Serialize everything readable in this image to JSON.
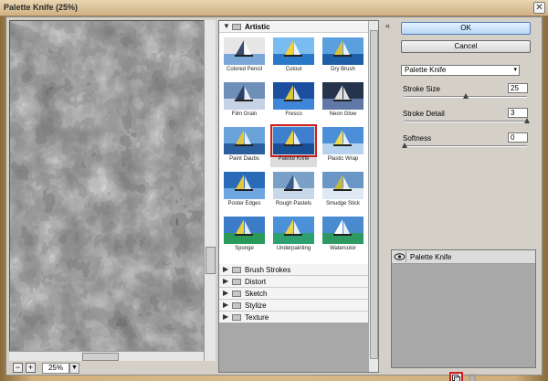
{
  "window": {
    "title": "Palette Knife (25%)",
    "close_glyph": "✕"
  },
  "preview": {
    "zoom_minus": "−",
    "zoom_plus": "+",
    "zoom_value": "25%",
    "zoom_dropdown_glyph": "▼"
  },
  "gallery": {
    "artistic": {
      "label": "Artistic",
      "filters": [
        {
          "label": "Colored Pencil",
          "selected": false
        },
        {
          "label": "Cutout",
          "selected": false
        },
        {
          "label": "Dry Brush",
          "selected": false
        },
        {
          "label": "Film Grain",
          "selected": false
        },
        {
          "label": "Fresco",
          "selected": false
        },
        {
          "label": "Neon Glow",
          "selected": false
        },
        {
          "label": "Paint Daubs",
          "selected": false
        },
        {
          "label": "Palette Knife",
          "selected": true
        },
        {
          "label": "Plastic Wrap",
          "selected": false
        },
        {
          "label": "Poster Edges",
          "selected": false
        },
        {
          "label": "Rough Pastels",
          "selected": false
        },
        {
          "label": "Smudge Stick",
          "selected": false
        },
        {
          "label": "Sponge",
          "selected": false
        },
        {
          "label": "Underpainting",
          "selected": false
        },
        {
          "label": "Watercolor",
          "selected": false
        }
      ]
    },
    "collapsed_categories": [
      "Brush Strokes",
      "Distort",
      "Sketch",
      "Stylize",
      "Texture"
    ],
    "expanded_arrow": "▼",
    "collapsed_arrow": "▶"
  },
  "controls": {
    "collapse_glyph": "«",
    "ok_label": "OK",
    "cancel_label": "Cancel",
    "filter_select_value": "Palette Knife",
    "filter_select_arrow": "▾",
    "params": [
      {
        "label": "Stroke Size",
        "value": "25",
        "level": 0.5
      },
      {
        "label": "Stroke Detail",
        "value": "3",
        "level": 1.0
      },
      {
        "label": "Softness",
        "value": "0",
        "level": 0.0
      }
    ]
  },
  "layers": {
    "items": [
      {
        "label": "Palette Knife"
      }
    ]
  },
  "colors": {
    "selection_highlight": "#cc1f1f",
    "ok_button": "#b8d7f5"
  }
}
